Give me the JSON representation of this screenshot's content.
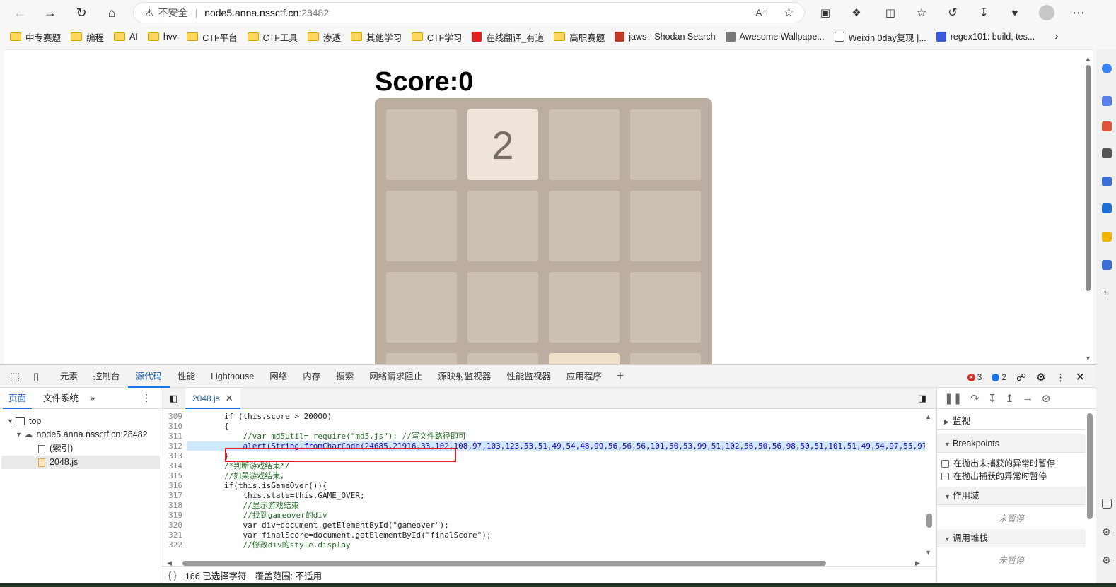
{
  "toolbar": {
    "insecure_label": "不安全",
    "url_host": "node5.anna.nssctf.cn",
    "url_port": ":28482"
  },
  "bookmarks": [
    {
      "label": "中专赛题",
      "icon": "folder"
    },
    {
      "label": "编程",
      "icon": "folder"
    },
    {
      "label": "AI",
      "icon": "folder"
    },
    {
      "label": "hvv",
      "icon": "folder"
    },
    {
      "label": "CTF平台",
      "icon": "folder"
    },
    {
      "label": "CTF工具",
      "icon": "folder"
    },
    {
      "label": "渗透",
      "icon": "folder"
    },
    {
      "label": "其他学习",
      "icon": "folder"
    },
    {
      "label": "CTF学习",
      "icon": "folder"
    },
    {
      "label": "在线翻译_有道",
      "icon": "youdao"
    },
    {
      "label": "高职赛题",
      "icon": "folder"
    },
    {
      "label": "jaws - Shodan Search",
      "icon": "shodan"
    },
    {
      "label": "Awesome Wallpape...",
      "icon": "wallpaper"
    },
    {
      "label": "Weixin 0day复现 |...",
      "icon": "page"
    },
    {
      "label": "regex101: build, tes...",
      "icon": "regex"
    }
  ],
  "game": {
    "score_text": "Score:0",
    "tiles": [
      [
        "",
        "2",
        "",
        ""
      ],
      [
        "",
        "",
        "",
        ""
      ],
      [
        "",
        "",
        "",
        ""
      ],
      [
        "",
        "",
        "",
        ""
      ]
    ]
  },
  "devtools": {
    "tabs": [
      "元素",
      "控制台",
      "源代码",
      "性能",
      "Lighthouse",
      "网络",
      "内存",
      "搜索",
      "网络请求阻止",
      "源映射监视器",
      "性能监视器",
      "应用程序"
    ],
    "active_tab": "源代码",
    "error_count": "3",
    "info_count": "2",
    "nav": {
      "tabs": [
        "页面",
        "文件系统"
      ],
      "tree": {
        "top": "top",
        "host": "node5.anna.nssctf.cn:28482",
        "index": "(索引)",
        "file": "2048.js"
      }
    },
    "editor": {
      "file_tab": "2048.js",
      "lines": [
        {
          "n": "309",
          "code": "        if (this.score > 20000)"
        },
        {
          "n": "310",
          "code": "        {"
        },
        {
          "n": "311",
          "code": "            //var md5util= require(\"md5.js\"); //写文件路径即可"
        },
        {
          "n": "312",
          "code": "            alert(String.fromCharCode(24685,21916,33,102,108,97,103,123,53,51,49,54,48,99,56,56,56,101,50,53,99,51,102,56,50,56,98,50,51,101,51,49,54,97,55,97"
        },
        {
          "n": "313",
          "code": "        }"
        },
        {
          "n": "314",
          "code": "        /*判断游戏结束*/"
        },
        {
          "n": "315",
          "code": "        //如果游戏结束，"
        },
        {
          "n": "316",
          "code": "        if(this.isGameOver()){"
        },
        {
          "n": "317",
          "code": "            this.state=this.GAME_OVER;"
        },
        {
          "n": "318",
          "code": "            //显示游戏结束"
        },
        {
          "n": "319",
          "code": "            //找到gameover的div"
        },
        {
          "n": "320",
          "code": "            var div=document.getElementById(\"gameover\");"
        },
        {
          "n": "321",
          "code": "            var finalScore=document.getElementById(\"finalScore\");"
        },
        {
          "n": "322",
          "code": "            //修改div的style.display"
        }
      ],
      "status_braces": "{ }",
      "status_selected": "166 已选择字符",
      "status_coverage": "覆盖范围: 不适用"
    },
    "debugger": {
      "watch": "监视",
      "breakpoints": "Breakpoints",
      "pause_uncaught": "在抛出未捕获的异常时暂停",
      "pause_caught": "在抛出捕获的异常时暂停",
      "scope": "作用域",
      "not_paused_1": "未暂停",
      "call_stack": "调用堆栈",
      "not_paused_2": "未暂停"
    }
  }
}
